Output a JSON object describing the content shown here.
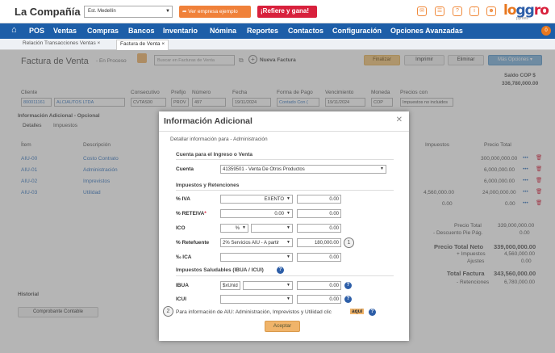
{
  "topbar": {
    "company": "La Compañía",
    "establishment": "Est. Medellín",
    "demo_button": "Ver empresa ejemplo",
    "refer_button": "¡Refiere y gana!",
    "logo": "loggro",
    "logo_sub": "pymes"
  },
  "nav": {
    "items": [
      "POS",
      "Ventas",
      "Compras",
      "Bancos",
      "Inventario",
      "Nómina",
      "Reportes",
      "Contactos",
      "Configuración",
      "Opciones Avanzadas"
    ],
    "badge": "0"
  },
  "tabs": [
    "Relación Transacciones Ventas",
    "Factura de Venta"
  ],
  "page": {
    "title": "Factura de Venta",
    "state": "- En Proceso",
    "search_placeholder": "Buscar en Facturas de Venta",
    "new_invoice": "Nueva Factura",
    "finalize": "Finalizar",
    "print": "Imprimir",
    "delete": "Eliminar",
    "more": "Más Opciones",
    "balance_label": "Saldo COP $",
    "balance_value": "336,780,000.00"
  },
  "header_fields": {
    "cliente_label": "Cliente",
    "cliente_code": "800011161",
    "cliente_name": "ALCIAUTOS LTDA",
    "consecutivo_label": "Consecutivo",
    "consecutivo": "CVTAS00",
    "prefijo_label": "Prefijo",
    "prefijo": "PROV",
    "numero_label": "Número",
    "numero": "497",
    "fecha_label": "Fecha",
    "fecha": "19/11/2024",
    "forma_label": "Forma de Pago",
    "forma": "Contado Con (",
    "venc_label": "Vencimiento",
    "venc": "19/11/2024",
    "moneda_label": "Moneda",
    "moneda": "COP",
    "precios_label": "Precios con",
    "precios": "Impuestos no incluidos"
  },
  "info_adicional": "Información Adicional - Opcional",
  "subtabs": [
    "Detalles",
    "Impuestos"
  ],
  "table": {
    "headers": [
      "Ítem",
      "Descripción",
      "Impuestos",
      "Precio Total"
    ],
    "rows": [
      {
        "item": "AIU-00",
        "desc": "Costo Contrato",
        "imp": "",
        "total": "300,000,000.00"
      },
      {
        "item": "AIU-01",
        "desc": "Administración",
        "imp": "",
        "total": "6,000,000.00"
      },
      {
        "item": "AIU-02",
        "desc": "Imprevistos",
        "imp": "",
        "total": "6,000,000.00"
      },
      {
        "item": "AIU-03",
        "desc": "Utilidad",
        "imp": "4,560,000.00",
        "total": "24,000,000.00"
      },
      {
        "item": "",
        "desc": "",
        "imp": "0.00",
        "total": "0.00"
      }
    ]
  },
  "totals": [
    {
      "label": "Precio Total",
      "value": "339,000,000.00"
    },
    {
      "label": "- Descuento Pie Pág.",
      "value": "0.00"
    },
    {
      "label": "Precio Total Neto",
      "value": "339,000,000.00"
    },
    {
      "label": "+ Impuestos",
      "value": "4,560,000.00"
    },
    {
      "label": "Ajustes",
      "value": "0.00"
    },
    {
      "label": "Total Factura",
      "value": "343,560,000.00"
    },
    {
      "label": "- Retenciones",
      "value": "6,780,000.00"
    }
  ],
  "historial": "Historial",
  "comprobante": "Comprobante Contable",
  "modal": {
    "title": "Información Adicional",
    "subtitle": "Detallar información para - Administración",
    "sec_cuenta": "Cuenta para el Ingreso o Venta",
    "cuenta_label": "Cuenta",
    "cuenta_value": "41359501 - Venta De Otros Productos",
    "sec_impuestos": "Impuestos y Retenciones",
    "iva_label": "% IVA",
    "iva_select": "EXENTO",
    "iva_value": "0.00",
    "reteiva_label": "% RETEIVA",
    "reteiva_select": "0.00",
    "reteiva_value": "0.00",
    "ico_label": "ICO",
    "ico_unit": "%",
    "ico_value": "0.00",
    "retefuente_label": "% Retefuente",
    "retefuente_select": "2% Servicios AIU - A partir",
    "retefuente_value": "180,000.00",
    "ica_label": "‰ ICA",
    "ica_value": "0.00",
    "sec_saludables": "Impuestos Saludables (IBUA / ICUI)",
    "ibua_label": "IBUA",
    "ibua_unit": "$xUnid",
    "ibua_value": "0.00",
    "icui_label": "ICUI",
    "icui_value": "0.00",
    "aiu_text": "Para información de AIU: Administración, Imprevistos y Utilidad clic",
    "aiu_link": "aquí",
    "accept": "Aceptar",
    "marker1": "1",
    "marker2": "2"
  }
}
